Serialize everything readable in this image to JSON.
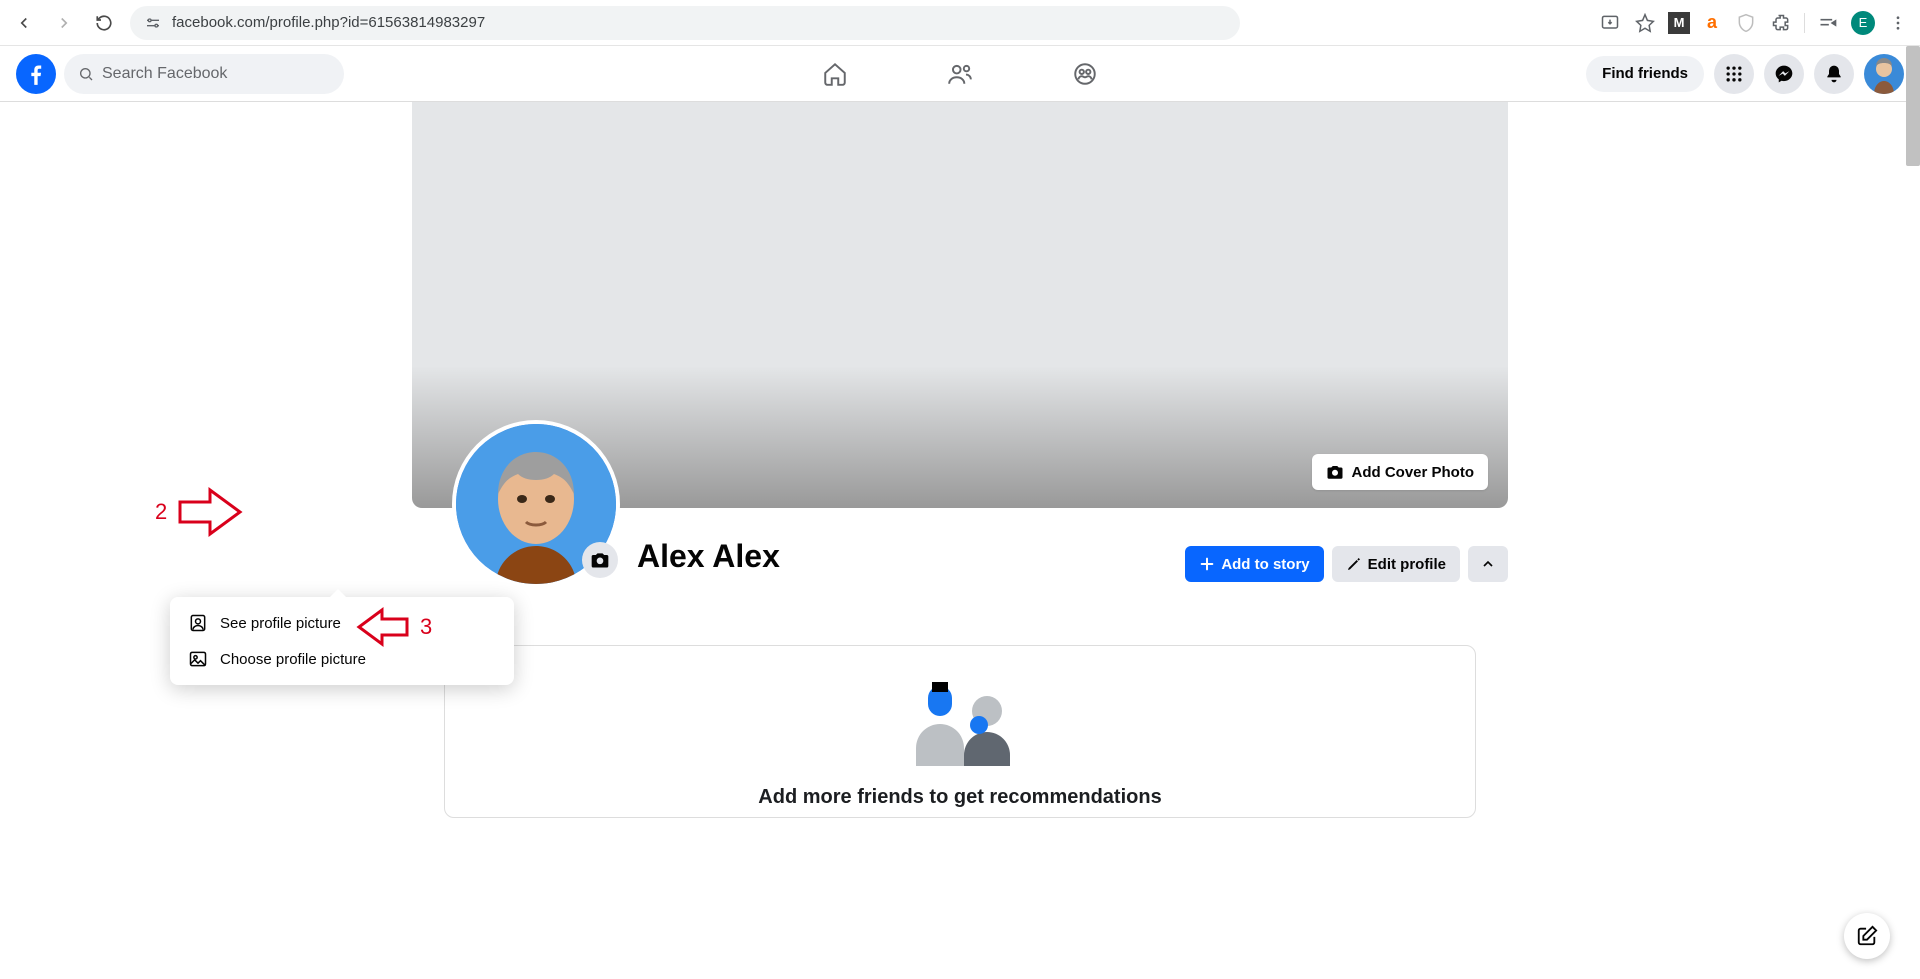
{
  "browser": {
    "url": "facebook.com/profile.php?id=61563814983297",
    "avatar_letter": "E"
  },
  "topbar": {
    "search_placeholder": "Search Facebook",
    "find_friends": "Find friends"
  },
  "profile": {
    "name": "Alex Alex",
    "add_cover": "Add Cover Photo",
    "add_story": "Add to story",
    "edit_profile": "Edit profile"
  },
  "pic_menu": {
    "see": "See profile picture",
    "choose": "Choose profile picture"
  },
  "recommendations": {
    "title": "Add more friends to get recommendations"
  },
  "annotations": {
    "step2": "2",
    "step3": "3"
  }
}
